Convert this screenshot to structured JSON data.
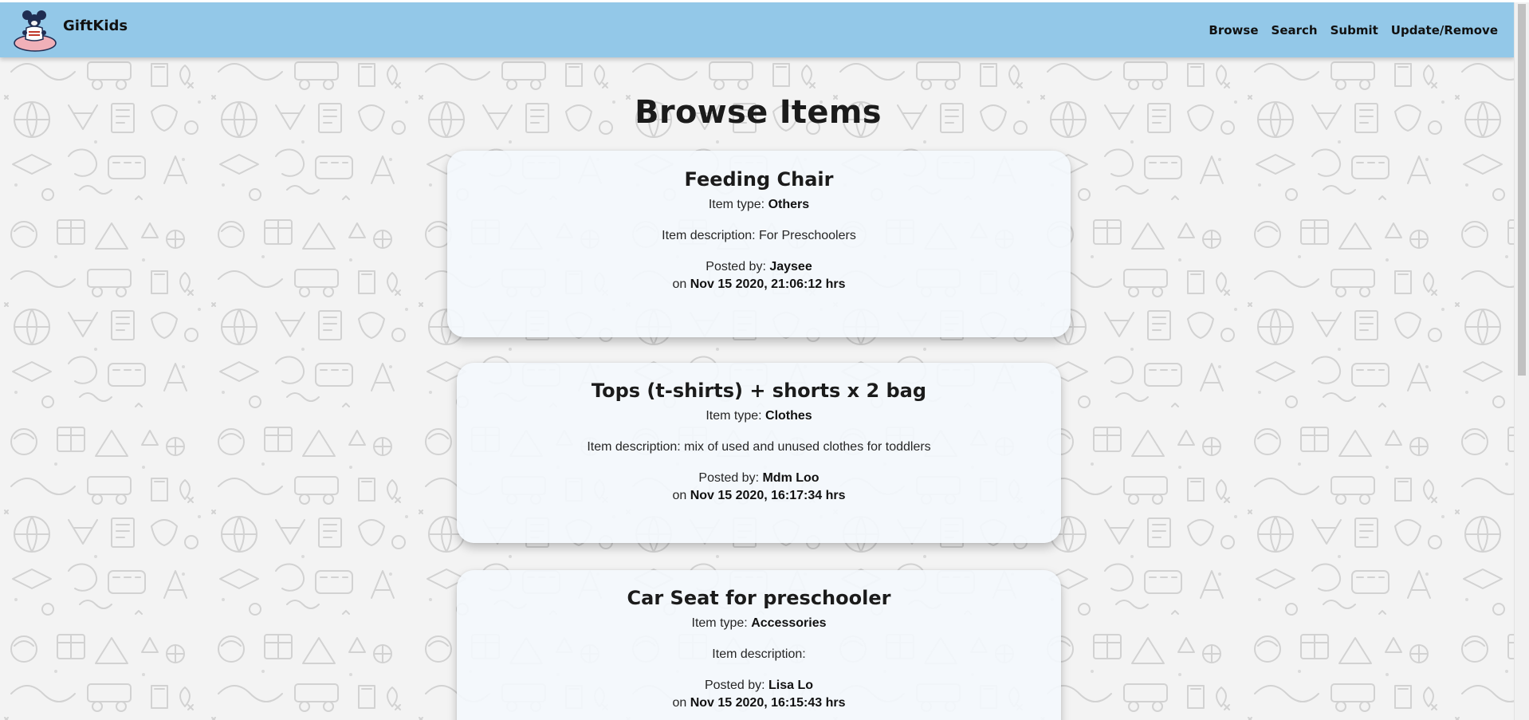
{
  "brand": {
    "name": "GiftKids"
  },
  "nav": {
    "items": [
      {
        "label": "Browse"
      },
      {
        "label": "Search"
      },
      {
        "label": "Submit"
      },
      {
        "label": "Update/Remove"
      }
    ]
  },
  "page": {
    "title": "Browse Items"
  },
  "labels": {
    "item_type": "Item type: ",
    "item_description": "Item description: ",
    "posted_by": "Posted by: ",
    "on": "on "
  },
  "items": [
    {
      "title": "Feeding Chair",
      "type": "Others",
      "description": "For Preschoolers",
      "posted_by": "Jaysee",
      "date": "Nov 15 2020, 21:06:12 hrs"
    },
    {
      "title": "Tops (t-shirts) + shorts x 2 bag",
      "type": "Clothes",
      "description": "mix of used and unused clothes for toddlers",
      "posted_by": "Mdm Loo",
      "date": "Nov 15 2020, 16:17:34 hrs"
    },
    {
      "title": "Car Seat for preschooler",
      "type": "Accessories",
      "description": "",
      "posted_by": "Lisa Lo",
      "date": "Nov 15 2020, 16:15:43 hrs"
    }
  ],
  "colors": {
    "navbar": "#93c8e8",
    "card": "#f3f7fc",
    "background": "#f3f3f3"
  },
  "icons": {
    "logo": "mouse-mascot-logo"
  }
}
